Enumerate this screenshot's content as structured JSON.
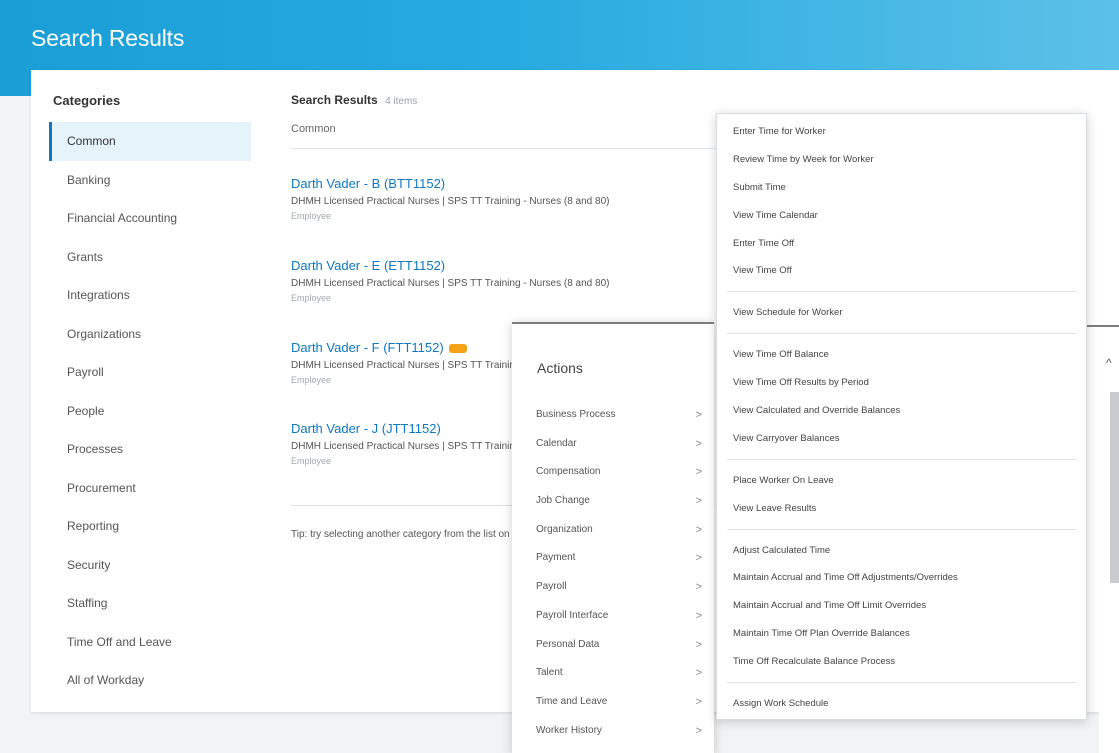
{
  "header": {
    "title": "Search Results"
  },
  "categories": {
    "title": "Categories",
    "items": [
      {
        "label": "Common"
      },
      {
        "label": "Banking"
      },
      {
        "label": "Financial Accounting"
      },
      {
        "label": "Grants"
      },
      {
        "label": "Integrations"
      },
      {
        "label": "Organizations"
      },
      {
        "label": "Payroll"
      },
      {
        "label": "People"
      },
      {
        "label": "Processes"
      },
      {
        "label": "Procurement"
      },
      {
        "label": "Reporting"
      },
      {
        "label": "Security"
      },
      {
        "label": "Staffing"
      },
      {
        "label": "Time Off and Leave"
      },
      {
        "label": "All of Workday"
      }
    ],
    "active": "Common"
  },
  "results": {
    "title": "Search Results",
    "count": "4 items",
    "column": "Common",
    "items": [
      {
        "name": "Darth Vader - B (BTT1152)",
        "desc": "DHMH Licensed Practical Nurses | SPS TT Training - Nurses (8 and 80)",
        "type": "Employee"
      },
      {
        "name": "Darth Vader - E (ETT1152)",
        "desc": "DHMH Licensed Practical Nurses | SPS TT Training - Nurses (8 and 80)",
        "type": "Employee"
      },
      {
        "name": "Darth Vader - F (FTT1152)",
        "desc": "DHMH Licensed Practical Nurses | SPS TT Training - Nurses (8 and 80)",
        "type": "Employee"
      },
      {
        "name": "Darth Vader - J (JTT1152)",
        "desc": "DHMH Licensed Practical Nurses | SPS TT Training - Nurses (8 and 80)",
        "type": "Employee"
      }
    ],
    "tip": "Tip: try selecting another category from the list on the left"
  },
  "actions": {
    "title": "Actions",
    "items": [
      {
        "label": "Business Process"
      },
      {
        "label": "Calendar"
      },
      {
        "label": "Compensation"
      },
      {
        "label": "Job Change"
      },
      {
        "label": "Organization"
      },
      {
        "label": "Payment"
      },
      {
        "label": "Payroll"
      },
      {
        "label": "Payroll Interface"
      },
      {
        "label": "Personal Data"
      },
      {
        "label": "Talent"
      },
      {
        "label": "Time and Leave"
      },
      {
        "label": "Worker History"
      }
    ],
    "chevron": ">"
  },
  "submenu": {
    "groups": [
      [
        "Enter Time for Worker",
        "Review Time by Week for Worker",
        "Submit Time",
        "View Time Calendar",
        "Enter Time Off",
        "View Time Off"
      ],
      [
        "View Schedule for Worker"
      ],
      [
        "View Time Off Balance",
        "View Time Off Results by Period",
        "View Calculated and Override Balances",
        "View Carryover Balances"
      ],
      [
        "Place Worker On Leave",
        "View Leave Results"
      ],
      [
        "Adjust Calculated Time",
        "Maintain Accrual and Time Off Adjustments/Overrides",
        "Maintain Accrual and Time Off Limit Overrides",
        "Maintain Time Off Plan Override Balances",
        "Time Off Recalculate Balance Process"
      ],
      [
        "Assign Work Schedule"
      ]
    ]
  },
  "scrollbar": {
    "up_glyph": "^"
  },
  "colors": {
    "header": "#1a9ed6",
    "link": "#0f78c0",
    "badge": "#f3a21a",
    "active_bg": "#e5f3fb"
  }
}
